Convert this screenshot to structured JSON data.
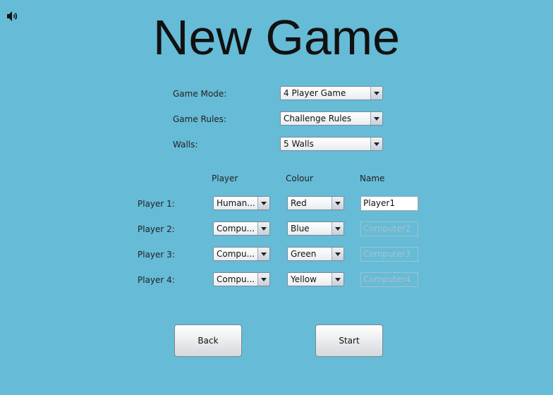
{
  "title": "New Game",
  "icons": {
    "sound": "speaker-volume-icon"
  },
  "settings": {
    "game_mode": {
      "label": "Game Mode:",
      "value": "4 Player Game"
    },
    "game_rules": {
      "label": "Game Rules:",
      "value": "Challenge Rules"
    },
    "walls": {
      "label": "Walls:",
      "value": "5 Walls"
    }
  },
  "headers": {
    "player": "Player",
    "colour": "Colour",
    "name": "Name"
  },
  "players": [
    {
      "label": "Player 1:",
      "type": "Human...",
      "colour": "Red",
      "name": "Player1",
      "name_editable": true
    },
    {
      "label": "Player 2:",
      "type": "Compu...",
      "colour": "Blue",
      "name": "Computer2",
      "name_editable": false
    },
    {
      "label": "Player 3:",
      "type": "Compu...",
      "colour": "Green",
      "name": "Computer3",
      "name_editable": false
    },
    {
      "label": "Player 4:",
      "type": "Compu...",
      "colour": "Yellow",
      "name": "Computer4",
      "name_editable": false
    }
  ],
  "buttons": {
    "back": "Back",
    "start": "Start"
  },
  "colors": {
    "background": "#66bbd6"
  }
}
